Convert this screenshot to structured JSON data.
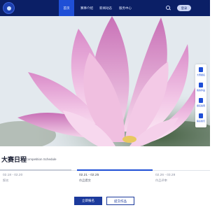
{
  "nav": {
    "items": [
      {
        "label": "首页"
      },
      {
        "label": "赛事介绍"
      },
      {
        "label": "新闻动态"
      },
      {
        "label": "服务中心"
      }
    ],
    "login_label": "登录"
  },
  "side_tools": [
    {
      "label": "大赛报名"
    },
    {
      "label": "我的作品"
    },
    {
      "label": "报名指南"
    },
    {
      "label": "联系我们"
    }
  ],
  "schedule": {
    "title": "大赛日程",
    "subtitle": "/ Competition Schedule",
    "phases": [
      {
        "date": "02.18 - 02.20",
        "name": "报名",
        "state": "done"
      },
      {
        "date": "02.21 - 02.25",
        "name": "作品提交",
        "state": "active"
      },
      {
        "date": "02.26 - 03.28",
        "name": "作品评审",
        "state": "upcoming"
      }
    ]
  },
  "actions": {
    "primary_label": "立即报名",
    "secondary_label": "提交作品"
  },
  "colors": {
    "nav_bg": "#0b1f66",
    "accent": "#1f4fd6",
    "button_primary": "#1c3a9c"
  }
}
